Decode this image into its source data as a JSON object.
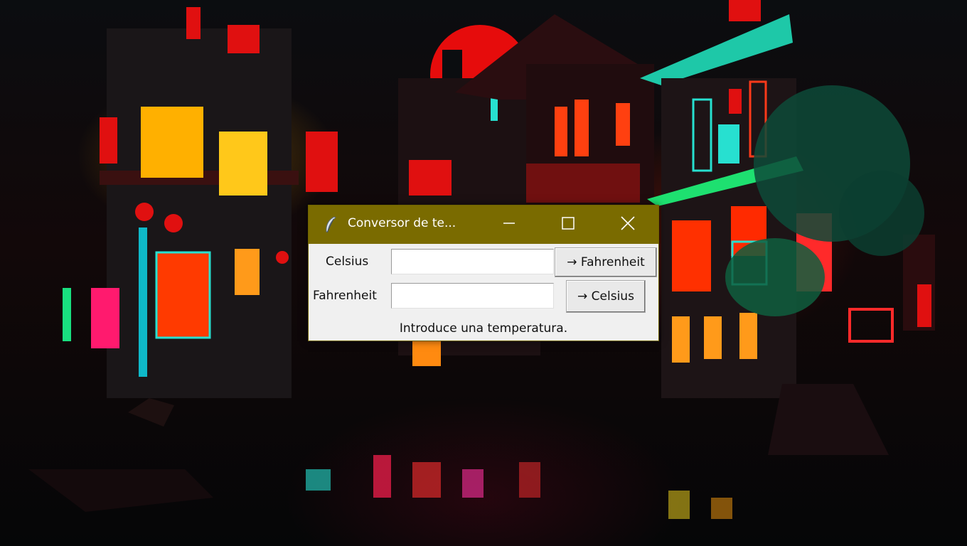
{
  "window": {
    "title": "Conversor de te...",
    "titlebar_color": "#7a6b00",
    "controls": {
      "minimize_icon": "minimize-icon",
      "maximize_icon": "maximize-icon",
      "close_icon": "close-icon"
    },
    "app_icon": "feather-icon"
  },
  "form": {
    "celsius_label": "Celsius",
    "celsius_value": "",
    "fahrenheit_label": "Fahrenheit",
    "fahrenheit_value": "",
    "to_fahrenheit_button": "→ Fahrenheit",
    "to_celsius_button": "→ Celsius",
    "status": "Introduce una temperatura."
  }
}
